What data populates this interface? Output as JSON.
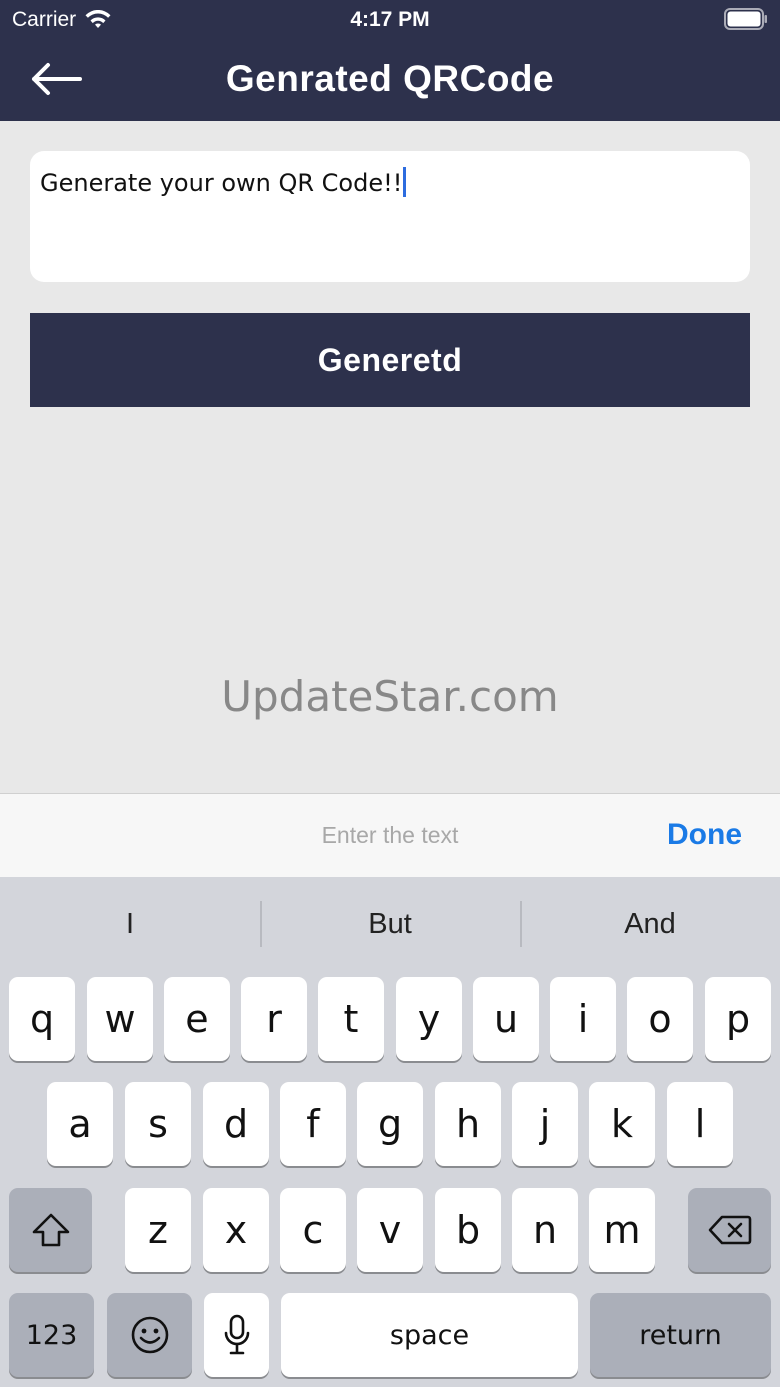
{
  "status_bar": {
    "carrier": "Carrier",
    "time": "4:17 PM"
  },
  "nav": {
    "title": "Genrated QRCode"
  },
  "input": {
    "value": "Generate your own QR Code!!"
  },
  "generate_button": {
    "label": "Generetd"
  },
  "watermark": "UpdateStar.com",
  "accessory": {
    "placeholder": "Enter the text",
    "done_label": "Done"
  },
  "keyboard": {
    "suggestions": [
      "I",
      "But",
      "And"
    ],
    "row1": [
      "q",
      "w",
      "e",
      "r",
      "t",
      "y",
      "u",
      "i",
      "o",
      "p"
    ],
    "row2": [
      "a",
      "s",
      "d",
      "f",
      "g",
      "h",
      "j",
      "k",
      "l"
    ],
    "row3": [
      "z",
      "x",
      "c",
      "v",
      "b",
      "n",
      "m"
    ],
    "numbers_label": "123",
    "space_label": "space",
    "return_label": "return"
  },
  "colors": {
    "nav_bg": "#2d314c",
    "accent": "#1a7ae6",
    "background": "#e8e8e8"
  }
}
